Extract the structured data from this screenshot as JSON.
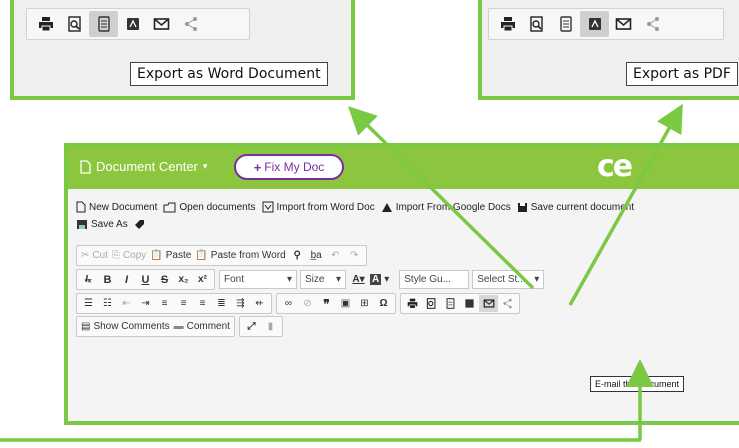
{
  "colors": {
    "accent_green": "#7ac943",
    "header_green": "#8cc63f",
    "fix_purple": "#7b2f9e"
  },
  "callout_left": {
    "icons": [
      "print-icon",
      "preview-icon",
      "word-doc-icon",
      "pdf-icon",
      "email-icon",
      "share-icon"
    ],
    "tooltip": "Export as Word Document"
  },
  "callout_right": {
    "icons": [
      "print-icon",
      "preview-icon",
      "word-doc-icon",
      "pdf-icon",
      "email-icon",
      "share-icon"
    ],
    "tooltip": "Export as PDF"
  },
  "header": {
    "document_center": "Document Center",
    "fix_button": "Fix My Doc",
    "logo": "ce"
  },
  "menu": {
    "new_document": "New Document",
    "open_documents": "Open documents",
    "import_word": "Import from Word Doc",
    "import_google": "Import From Google Docs",
    "save_current": "Save current document",
    "save_as": "Save As"
  },
  "toolbar": {
    "cut": "Cut",
    "copy": "Copy",
    "paste": "Paste",
    "paste_word": "Paste from Word",
    "font": "Font",
    "size": "Size",
    "style_guide": "Style Gu...",
    "select_style": "Select St...",
    "show_comments": "Show Comments",
    "comment": "Comment",
    "email_tooltip": "E-mail this document"
  }
}
